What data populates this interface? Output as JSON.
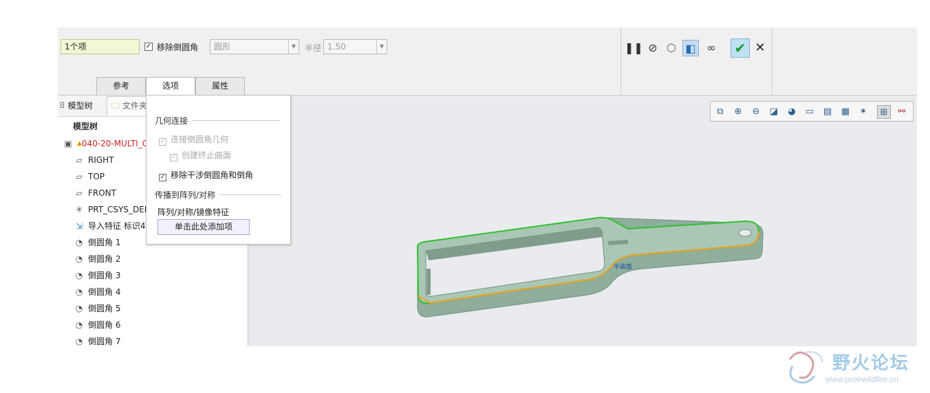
{
  "ribbon": {
    "item_count": "1个项",
    "remove_rounds_label": "移除倒圆角",
    "remove_rounds_checked": "☑",
    "shape_value": "圆形",
    "radius_label": "半径",
    "radius_value": "1.50",
    "tabs": [
      "参考",
      "选项",
      "属性"
    ],
    "active_tab": "选项"
  },
  "toolbar_icons": [
    "pause-icon",
    "stop-icon",
    "preview-icon",
    "verify-icon",
    "glasses-icon",
    "ok-icon",
    "cancel-icon"
  ],
  "left_panel": {
    "tab_model_tree": "模型树",
    "tab_folder": "文件夹",
    "tree_header": "模型树",
    "items": [
      {
        "icon": "part-icon",
        "label": "040-20-MULTI_C"
      },
      {
        "icon": "datum-plane-icon",
        "label": "RIGHT"
      },
      {
        "icon": "datum-plane-icon",
        "label": "TOP"
      },
      {
        "icon": "datum-plane-icon",
        "label": "FRONT"
      },
      {
        "icon": "csys-icon",
        "label": "PRT_CSYS_DEF"
      },
      {
        "icon": "import-feature-icon",
        "label": "导入特征 标识4"
      },
      {
        "icon": "round-icon",
        "label": "倒圆角 1"
      },
      {
        "icon": "round-icon",
        "label": "倒圆角 2"
      },
      {
        "icon": "round-icon",
        "label": "倒圆角 3"
      },
      {
        "icon": "round-icon",
        "label": "倒圆角 4"
      },
      {
        "icon": "round-icon",
        "label": "倒圆角 5"
      },
      {
        "icon": "round-icon",
        "label": "倒圆角 6"
      },
      {
        "icon": "round-icon",
        "label": "倒圆角 7"
      }
    ]
  },
  "options_panel": {
    "geometry_section": "几何连接",
    "connect_round_geometry": "连接倒圆角几何",
    "create_end_surface": "创建终止曲面",
    "remove_interfering": "移除干涉倒圆角和倒角",
    "propagate_section": "传播到阵列/对称",
    "pattern_features": "阵列/对称/镜像特征",
    "add_item_button": "单击此处添加项"
  },
  "graphics": {
    "label_tag": "半曲面",
    "view_toolbar_icons": [
      "refit-icon",
      "zoom-in-icon",
      "zoom-out-icon",
      "repaint-icon",
      "display-style-icon",
      "saved-views-icon",
      "view-manager-icon",
      "perspective-icon",
      "datum-display-icon",
      "spin-center-icon",
      "annotation-icon"
    ]
  },
  "colors": {
    "model_body": "#a9c7b4",
    "edge_green": "#2fbf2f",
    "edge_orange": "#f0a020",
    "ok_check": "#1a9a2a"
  },
  "watermark": {
    "title": "野火论坛",
    "url": "www.proewildfire.cn"
  }
}
